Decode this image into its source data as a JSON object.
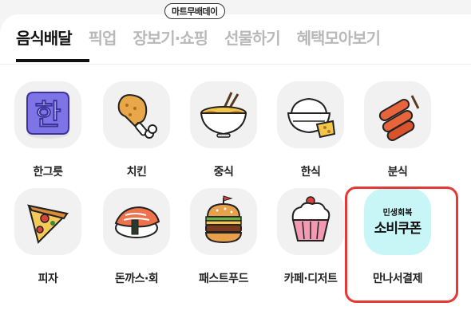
{
  "badge": "마트무배데이",
  "tabs": [
    "음식배달",
    "픽업",
    "장보기·쇼핑",
    "선물하기",
    "혜택모아보기"
  ],
  "categories": [
    {
      "label": "한그릇",
      "icon": "hangul-han-icon"
    },
    {
      "label": "치킨",
      "icon": "chicken-drumstick-icon"
    },
    {
      "label": "중식",
      "icon": "noodle-bowl-icon"
    },
    {
      "label": "한식",
      "icon": "rice-bowl-icon"
    },
    {
      "label": "분식",
      "icon": "tteokbokki-icon"
    },
    {
      "label": "피자",
      "icon": "pizza-slice-icon"
    },
    {
      "label": "돈까스·회",
      "icon": "sushi-icon"
    },
    {
      "label": "패스트푸드",
      "icon": "burger-icon"
    },
    {
      "label": "카페·디저트",
      "icon": "cupcake-icon"
    },
    {
      "label": "만나서결제",
      "icon": "coupon-banner-icon"
    }
  ],
  "coupon": {
    "line1": "민생회복",
    "line2": "소비쿠폰"
  },
  "colors": {
    "highlight": "#e53935",
    "coupon_bg": "#c8f6f7",
    "active_tab": "#111111",
    "inactive_tab": "#b9b9b9"
  }
}
